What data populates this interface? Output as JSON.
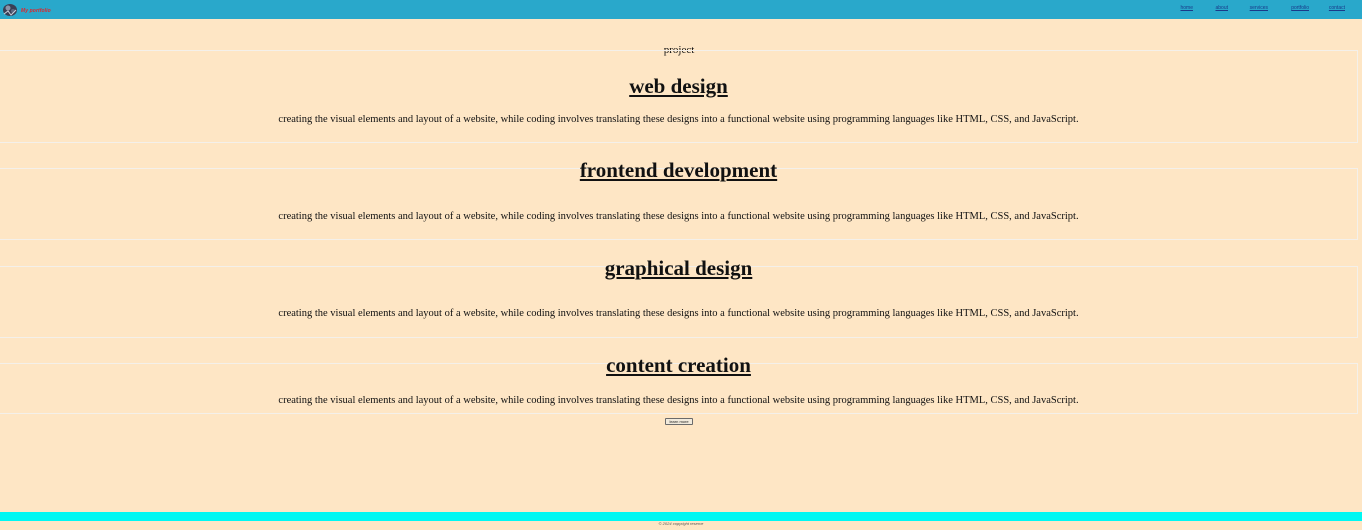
{
  "header": {
    "brand_name": "My portfolio",
    "nav": [
      {
        "label": "home"
      },
      {
        "label": "about"
      },
      {
        "label": "services"
      },
      {
        "label": "portfolio"
      },
      {
        "label": "contact"
      }
    ]
  },
  "main": {
    "page_label": "project",
    "sections": [
      {
        "title": "web design",
        "text": "creating the visual elements and layout of a website, while coding involves translating these designs into a functional website using programming languages like HTML, CSS, and JavaScript."
      },
      {
        "title": "frontend development",
        "text": "creating the visual elements and layout of a website, while coding involves translating these designs into a functional website using programming languages like HTML, CSS, and JavaScript."
      },
      {
        "title": "graphical design",
        "text": "creating the visual elements and layout of a website, while coding involves translating these designs into a functional website using programming languages like HTML, CSS, and JavaScript."
      },
      {
        "title": "content creation",
        "text": "creating the visual elements and layout of a website, while coding involves translating these designs into a functional website using programming languages like HTML, CSS, and JavaScript."
      }
    ],
    "learn_more_label": "learn more"
  },
  "footer": {
    "text": "© 2024 copyright reserve"
  },
  "colors": {
    "header_bg": "#29a8cb",
    "page_bg": "#fee6c5",
    "footer_bg": "#00f7f2",
    "brand_text": "#e0252a"
  }
}
